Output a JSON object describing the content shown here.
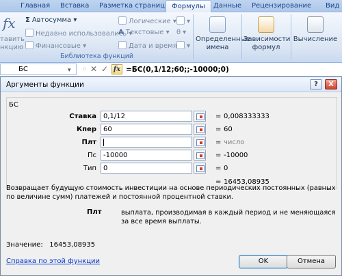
{
  "ribbon_tabs": [
    "Главная",
    "Вставка",
    "Разметка страницы",
    "Формулы",
    "Данные",
    "Рецензирование",
    "Вид"
  ],
  "active_tab": "Формулы",
  "ribbon": {
    "insert_function_partial": "тавить",
    "insert_function_partial2": "нкцию",
    "autosum": "Автосумма",
    "recently_used": "Недавно использовались",
    "financial": "Финансовые",
    "logical": "Логические",
    "text": "Текстовые",
    "datetime": "Дата и время",
    "group_label": "Библиотека функций",
    "defined_names_1": "Определенные",
    "defined_names_2": "имена",
    "dependencies_1": "Зависимости",
    "dependencies_2": "формул",
    "calculation": "Вычисление",
    "dropdown_glyph": "▾"
  },
  "formula_bar": {
    "name_box": "БС",
    "formula": "=БС(0,1/12;60;;-10000;0)"
  },
  "dialog": {
    "title": "Аргументы функции",
    "help_glyph": "?",
    "close_glyph": "X",
    "function_name": "БС",
    "args": [
      {
        "label": "Ставка",
        "value": "0,1/12",
        "result": "0,008333333",
        "bold": true
      },
      {
        "label": "Кпер",
        "value": "60",
        "result": "60",
        "bold": true
      },
      {
        "label": "Плт",
        "value": "",
        "result": "число",
        "bold": true
      },
      {
        "label": "Пс",
        "value": "-10000",
        "result": "-10000",
        "bold": false
      },
      {
        "label": "Тип",
        "value": "0",
        "result": "0",
        "bold": false
      }
    ],
    "eq_sign": "=",
    "total_result": "16453,08935",
    "description": "Возвращает будущую стоимость инвестиции на основе периодических постоянных (равных по величине сумм) платежей и постоянной процентной ставки.",
    "param_name": "Плт",
    "param_description": "выплата, производимая в каждый период и не меняющаяся за все время выплаты.",
    "value_label": "Значение:",
    "value": "16453,08935",
    "help_link": "Справка по этой функции",
    "ok": "OK",
    "cancel": "Отмена"
  }
}
